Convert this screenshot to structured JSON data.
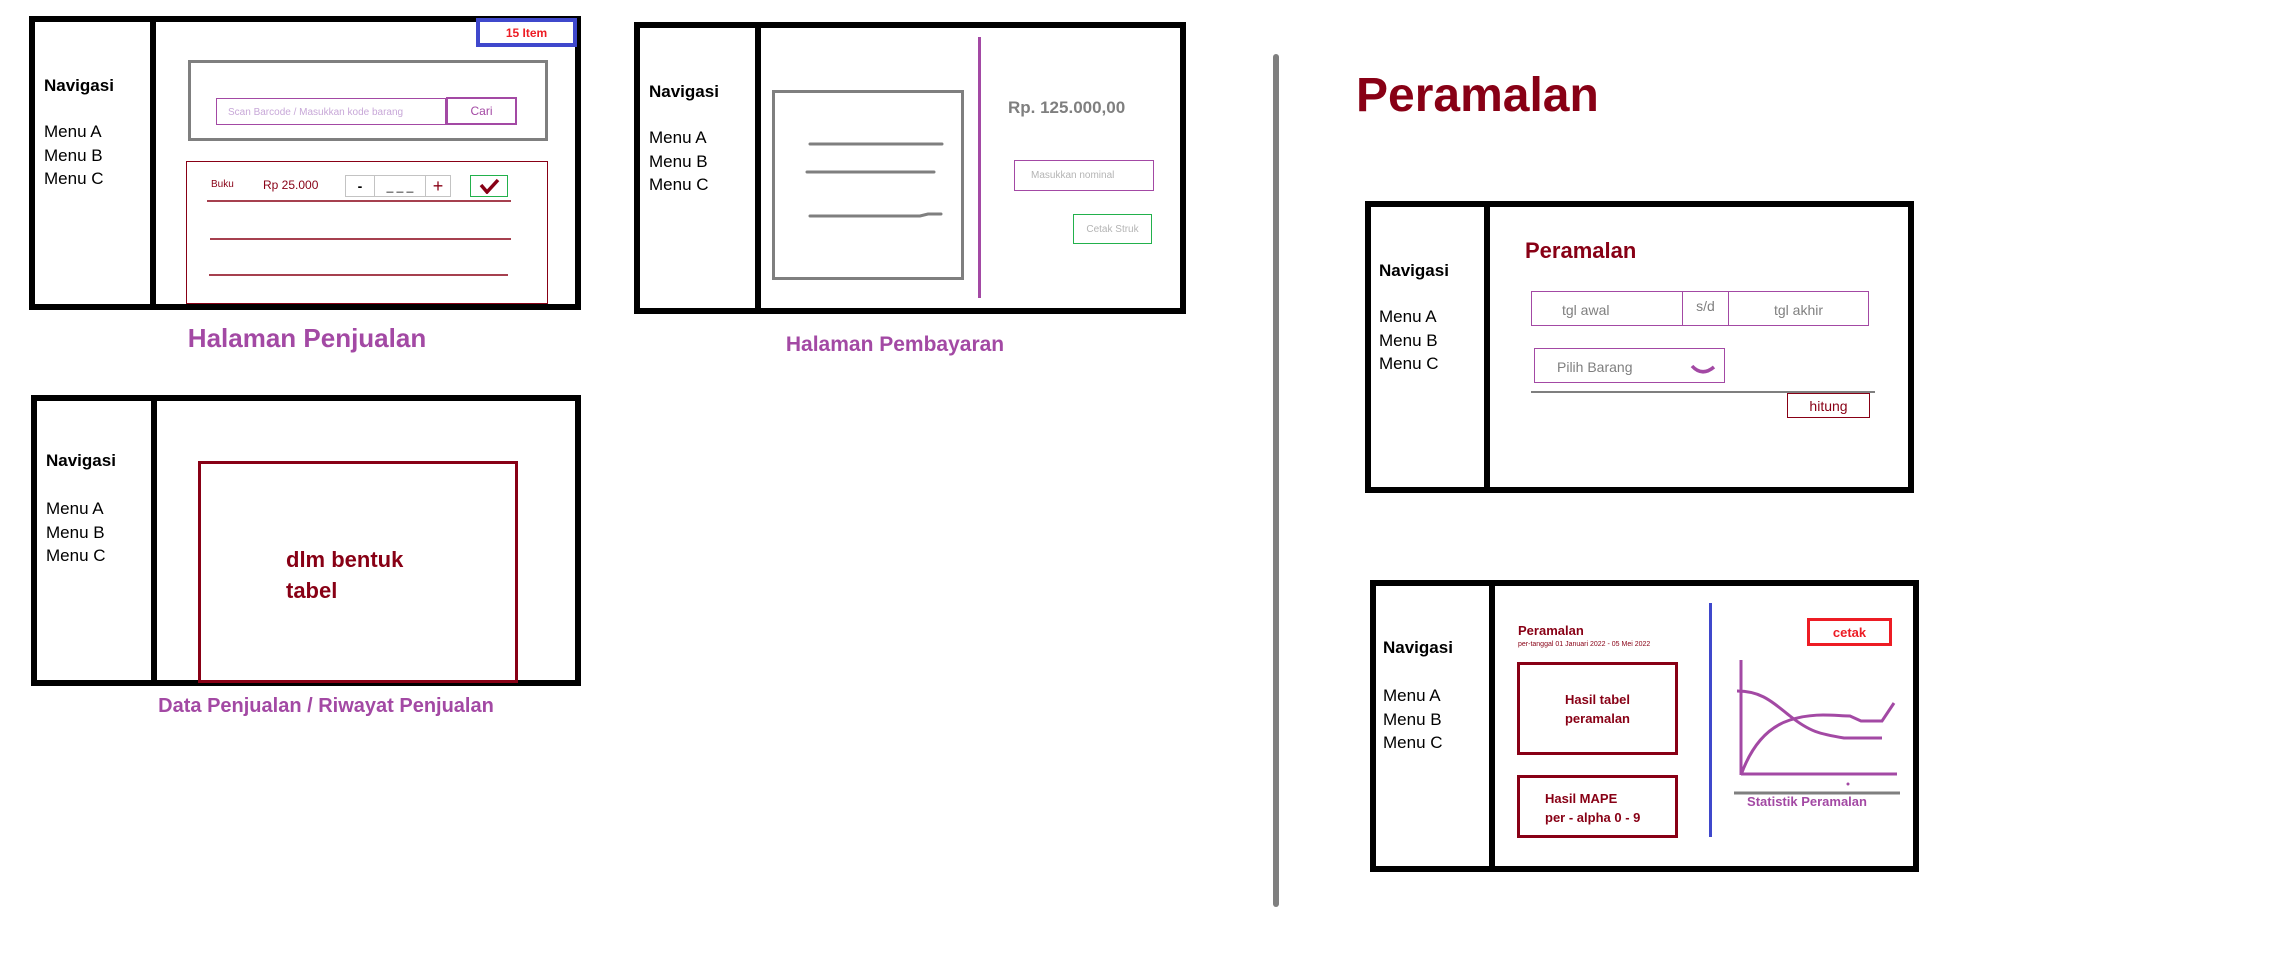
{
  "nav": {
    "title": "Navigasi",
    "items": [
      "Menu A",
      "Menu B",
      "Menu C"
    ]
  },
  "penjualan": {
    "item_count": "15 Item",
    "search_placeholder": "Scan Barcode / Masukkan kode barang",
    "search_button": "Cari",
    "row": {
      "name": "Buku",
      "price": "Rp 25.000",
      "minus": "-",
      "qty": "_ _ _",
      "plus": "+"
    },
    "caption": "Halaman Penjualan"
  },
  "pembayaran": {
    "total": "Rp. 125.000,00",
    "nominal_placeholder": "Masukkan nominal",
    "print_button": "Cetak Struk",
    "caption": "Halaman Pembayaran"
  },
  "riwayat": {
    "table_note_line1": "dlm bentuk",
    "table_note_line2": "tabel",
    "caption": "Data Penjualan / Riwayat Penjualan"
  },
  "peramalan_heading": "Peramalan",
  "peramalan_form": {
    "title": "Peramalan",
    "start_date_placeholder": "tgl awal",
    "separator": "s/d",
    "end_date_placeholder": "tgl akhir",
    "item_select": "Pilih Barang",
    "calculate_button": "hitung"
  },
  "peramalan_result": {
    "title": "Peramalan",
    "subtitle": "per-tanggal 01 Januari 2022 - 05 Mei 2022",
    "table_box_line1": "Hasil tabel",
    "table_box_line2": "peramalan",
    "mape_box_line1": "Hasil MAPE",
    "mape_box_line2": "per - alpha 0 - 9",
    "print_button": "cetak",
    "chart_caption": "Statistik Peramalan"
  },
  "colors": {
    "maroon": "#880015",
    "purple": "#a349a4",
    "blue": "#3f48cc",
    "green": "#22b14c",
    "red": "#ed1c24",
    "gray": "#7f7f7f"
  }
}
